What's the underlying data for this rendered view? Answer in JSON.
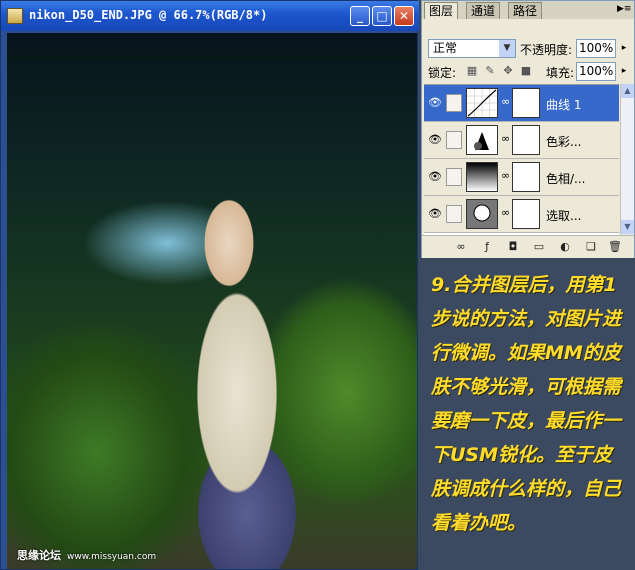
{
  "document": {
    "title": "nikon_D50_END.JPG @ 66.7%(RGB/8*)",
    "controls": {
      "minimize": "_",
      "maximize": "□",
      "close": "✕"
    },
    "watermark": {
      "text": "思缘论坛",
      "url": "www.missyuan.com"
    }
  },
  "layers_panel": {
    "tabs": [
      "图层",
      "通道",
      "路径"
    ],
    "active_tab": "图层",
    "blend_mode": "正常",
    "opacity_label": "不透明度:",
    "opacity_value": "100%",
    "lock_label": "锁定:",
    "fill_label": "填充:",
    "fill_value": "100%",
    "layers": [
      {
        "name": "曲线 1",
        "type": "curves",
        "visible": true,
        "selected": true
      },
      {
        "name": "色彩...",
        "type": "color-balance",
        "visible": true,
        "selected": false
      },
      {
        "name": "色相/...",
        "type": "hue-saturation",
        "visible": true,
        "selected": false
      },
      {
        "name": "选取...",
        "type": "selective-color",
        "visible": true,
        "selected": false
      }
    ],
    "footer_icons": [
      "link-icon",
      "layer-style-icon",
      "add-mask-icon",
      "new-group-icon",
      "new-adjustment-icon",
      "new-layer-icon",
      "trash-icon"
    ]
  },
  "caption": {
    "text": "9.合并图层后，用第1步说的方法，对图片进行微调。如果MM的皮肤不够光滑，可根据需要磨一下皮，最后作一下USM锐化。至于皮肤调成什么样的，自己看着办吧。",
    "color": "#ffdc2a"
  },
  "colors": {
    "title_bar": "#1d57cf",
    "selected_layer": "#3669c9",
    "caption_bg": "#3b4a60"
  }
}
